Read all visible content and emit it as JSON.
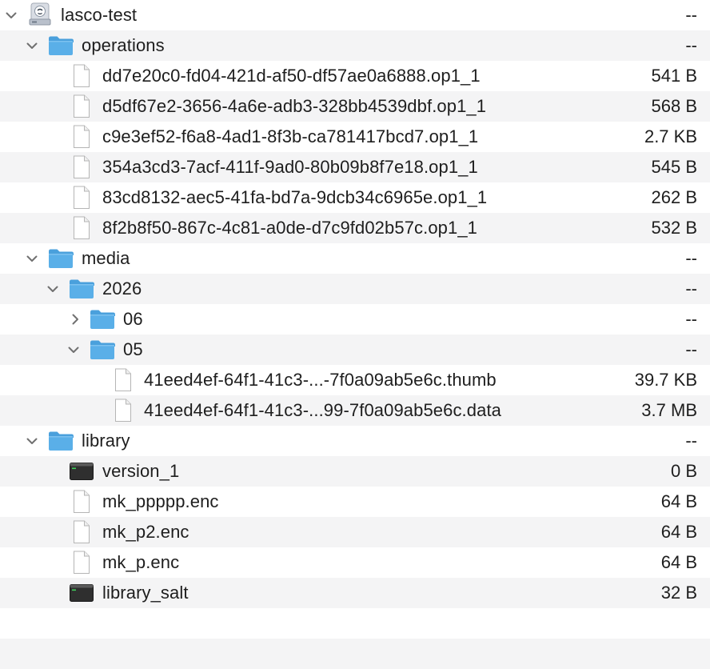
{
  "colors": {
    "folder": "#5aafe8",
    "folder_tab": "#4aa0dc",
    "row_alt": "#f4f4f5",
    "text": "#1e1e1e",
    "chevron": "#707070"
  },
  "rows": [
    {
      "name": "lasco-test",
      "size": "--",
      "icon": "drive-icon",
      "disclosure": "expanded"
    },
    {
      "name": "operations",
      "size": "--",
      "icon": "folder-icon",
      "disclosure": "expanded"
    },
    {
      "name": "dd7e20c0-fd04-421d-af50-df57ae0a6888.op1_1",
      "size": "541 B",
      "icon": "document-icon"
    },
    {
      "name": "d5df67e2-3656-4a6e-adb3-328bb4539dbf.op1_1",
      "size": "568 B",
      "icon": "document-icon"
    },
    {
      "name": "c9e3ef52-f6a8-4ad1-8f3b-ca781417bcd7.op1_1",
      "size": "2.7 KB",
      "icon": "document-icon"
    },
    {
      "name": "354a3cd3-7acf-411f-9ad0-80b09b8f7e18.op1_1",
      "size": "545 B",
      "icon": "document-icon"
    },
    {
      "name": "83cd8132-aec5-41fa-bd7a-9dcb34c6965e.op1_1",
      "size": "262 B",
      "icon": "document-icon"
    },
    {
      "name": "8f2b8f50-867c-4c81-a0de-d7c9fd02b57c.op1_1",
      "size": "532 B",
      "icon": "document-icon"
    },
    {
      "name": "media",
      "size": "--",
      "icon": "folder-icon",
      "disclosure": "expanded"
    },
    {
      "name": "2026",
      "size": "--",
      "icon": "folder-icon",
      "disclosure": "expanded"
    },
    {
      "name": "06",
      "size": "--",
      "icon": "folder-icon",
      "disclosure": "collapsed"
    },
    {
      "name": "05",
      "size": "--",
      "icon": "folder-icon",
      "disclosure": "expanded"
    },
    {
      "name": "41eed4ef-64f1-41c3-...-7f0a09ab5e6c.thumb",
      "size": "39.7 KB",
      "icon": "document-icon"
    },
    {
      "name": "41eed4ef-64f1-41c3-...99-7f0a09ab5e6c.data",
      "size": "3.7 MB",
      "icon": "document-icon"
    },
    {
      "name": "library",
      "size": "--",
      "icon": "folder-icon",
      "disclosure": "expanded"
    },
    {
      "name": "version_1",
      "size": "0 B",
      "icon": "executable-icon"
    },
    {
      "name": "mk_ppppp.enc",
      "size": "64 B",
      "icon": "document-icon"
    },
    {
      "name": "mk_p2.enc",
      "size": "64 B",
      "icon": "document-icon"
    },
    {
      "name": "mk_p.enc",
      "size": "64 B",
      "icon": "document-icon"
    },
    {
      "name": "library_salt",
      "size": "32 B",
      "icon": "executable-icon"
    }
  ]
}
